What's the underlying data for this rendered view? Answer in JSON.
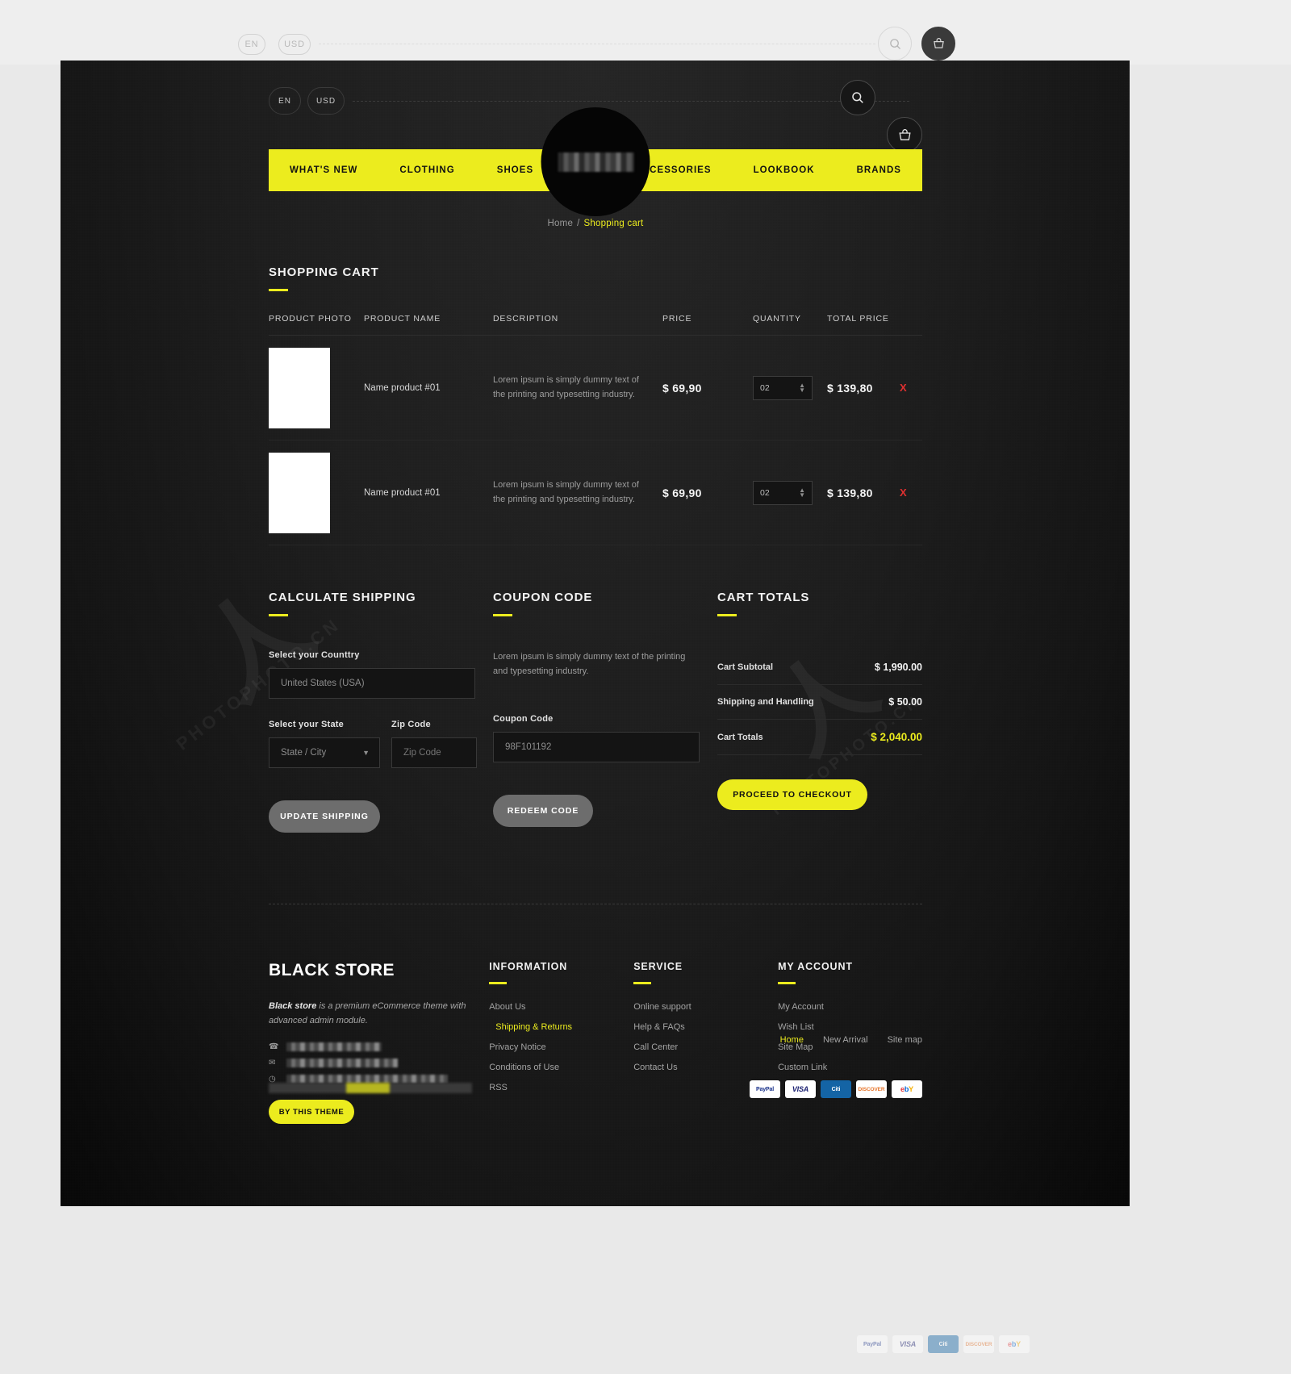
{
  "preview": {
    "lang": "EN",
    "currency": "USD"
  },
  "topbar": {
    "lang": "EN",
    "currency": "USD",
    "search_icon": "search-icon",
    "cart_icon": "basket-icon"
  },
  "nav": {
    "left_items": [
      "WHAT'S NEW",
      "CLOTHING",
      "SHOES"
    ],
    "right_items": [
      "ACCESSORIES",
      "LOOKBOOK",
      "BRANDS"
    ]
  },
  "breadcrumb": {
    "home": "Home",
    "separator": "/",
    "current": "Shopping cart"
  },
  "cart": {
    "title": "SHOPPING CART",
    "columns": [
      "PRODUCT PHOTO",
      "PRODUCT NAME",
      "DESCRIPTION",
      "PRICE",
      "QUANTITY",
      "TOTAL PRICE"
    ],
    "rows": [
      {
        "name": "Name product #01",
        "description": "Lorem ipsum is simply dummy text of the printing and typesetting industry.",
        "price": "$ 69,90",
        "quantity": "02",
        "total": "$ 139,80",
        "remove": "X"
      },
      {
        "name": "Name product #01",
        "description": "Lorem ipsum is simply dummy text of the printing and typesetting industry.",
        "price": "$ 69,90",
        "quantity": "02",
        "total": "$ 139,80",
        "remove": "X"
      }
    ]
  },
  "shipping": {
    "title": "CALCULATE SHIPPING",
    "country_label": "Select your Counttry",
    "country_value": "United States (USA)",
    "state_label": "Select your State",
    "state_value": "State / City",
    "zip_label": "Zip Code",
    "zip_placeholder": "Zip Code",
    "button": "UPDATE SHIPPING"
  },
  "coupon": {
    "title": "COUPON CODE",
    "text": "Lorem ipsum is simply dummy text of the printing and typesetting industry.",
    "label": "Coupon Code",
    "value": "98F101192",
    "button": "REDEEM CODE"
  },
  "totals": {
    "title": "CART TOTALS",
    "rows": [
      {
        "label": "Cart Subtotal",
        "value": "$ 1,990.00"
      },
      {
        "label": "Shipping and Handling",
        "value": "$ 50.00"
      },
      {
        "label": "Cart Totals",
        "value": "$ 2,040.00"
      }
    ],
    "checkout": "PROCEED TO CHECKOUT"
  },
  "footer": {
    "brand": "BLACK STORE",
    "about_strong": "Black store",
    "about_text": " is a premium eCommerce theme with advanced admin module.",
    "theme_button": "BY THIS THEME",
    "contact_icons": [
      "phone-icon",
      "mail-icon",
      "clock-icon"
    ],
    "columns": [
      {
        "title": "INFORMATION",
        "links": [
          {
            "label": "About Us",
            "active": false
          },
          {
            "label": "Shipping & Returns",
            "active": true
          },
          {
            "label": "Privacy Notice",
            "active": false
          },
          {
            "label": "Conditions of Use",
            "active": false
          },
          {
            "label": "RSS",
            "active": false
          }
        ]
      },
      {
        "title": "SERVICE",
        "links": [
          {
            "label": "Online support",
            "active": false
          },
          {
            "label": "Help & FAQs",
            "active": false
          },
          {
            "label": "Call Center",
            "active": false
          },
          {
            "label": "Contact Us",
            "active": false
          }
        ]
      },
      {
        "title": "MY ACCOUNT",
        "links": [
          {
            "label": "My Account",
            "active": false
          },
          {
            "label": "Wish List",
            "active": false
          },
          {
            "label": "Site Map",
            "active": false
          },
          {
            "label": "Custom Link",
            "active": false
          }
        ]
      }
    ],
    "bottom_links": [
      {
        "label": "Home",
        "active": true
      },
      {
        "label": "New Arrival",
        "active": false
      },
      {
        "label": "Site map",
        "active": false
      }
    ],
    "payments": [
      "PayPal",
      "VISA",
      "Citi",
      "DISCOVER",
      "ebay"
    ]
  },
  "colors": {
    "accent": "#ecec1e",
    "background": "#151515",
    "danger": "#e03030"
  }
}
